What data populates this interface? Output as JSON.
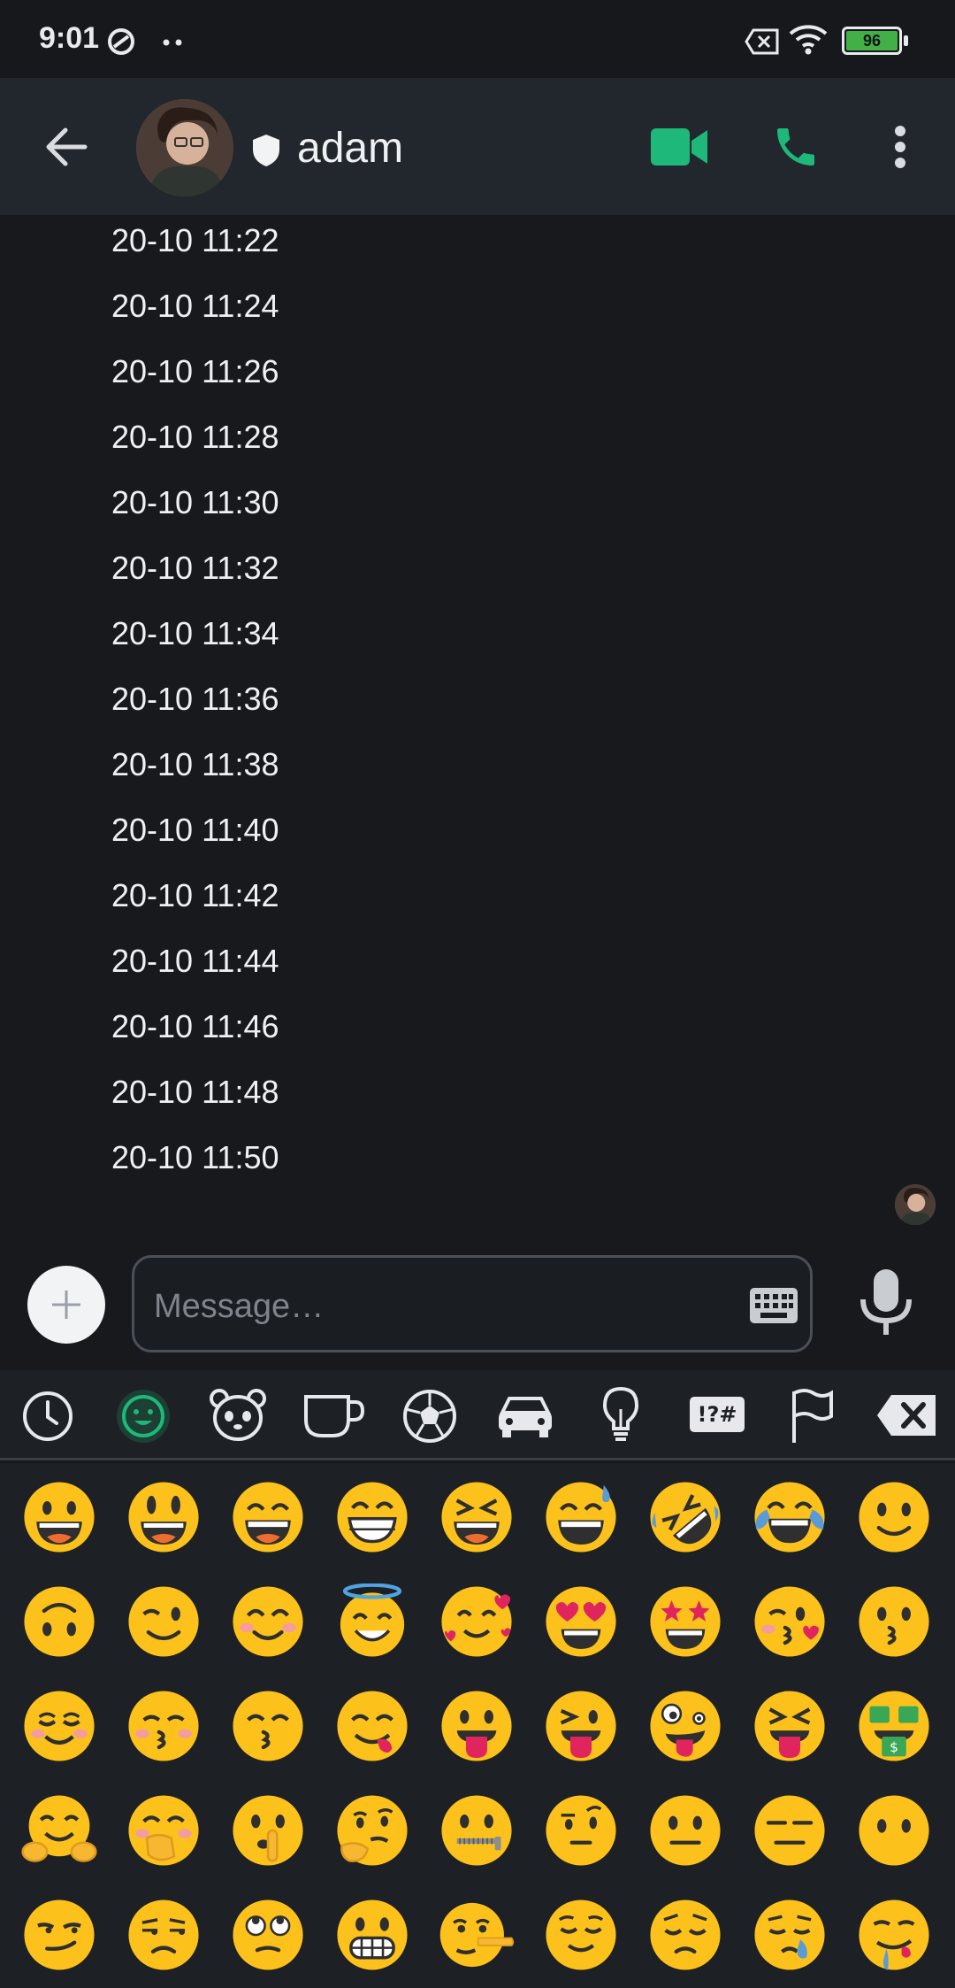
{
  "status_bar": {
    "time": "9:01",
    "battery": "96",
    "icons": [
      "do-not-disturb-icon",
      "more-notifications-icon",
      "no-sim-icon",
      "wifi-icon",
      "battery-icon"
    ]
  },
  "header": {
    "contact_name": "adam",
    "icons": [
      "back-arrow-icon",
      "shield-icon",
      "video-call-icon",
      "phone-icon",
      "more-vert-icon"
    ],
    "accent": "#1db87a"
  },
  "messages": {
    "timestamps": [
      "20-10 11:22",
      "20-10 11:24",
      "20-10 11:26",
      "20-10 11:28",
      "20-10 11:30",
      "20-10 11:32",
      "20-10 11:34",
      "20-10 11:36",
      "20-10 11:38",
      "20-10 11:40",
      "20-10 11:42",
      "20-10 11:44",
      "20-10 11:46",
      "20-10 11:48",
      "20-10 11:50"
    ]
  },
  "composer": {
    "placeholder": "Message…",
    "icons": [
      "add-icon",
      "keyboard-icon",
      "mic-icon"
    ]
  },
  "emoji_keyboard": {
    "tabs": [
      {
        "name": "recent-icon",
        "selected": false
      },
      {
        "name": "smileys-icon",
        "selected": true
      },
      {
        "name": "animals-icon",
        "selected": false
      },
      {
        "name": "food-icon",
        "selected": false
      },
      {
        "name": "activity-icon",
        "selected": false
      },
      {
        "name": "travel-icon",
        "selected": false
      },
      {
        "name": "objects-icon",
        "selected": false
      },
      {
        "name": "symbols-icon",
        "selected": false
      },
      {
        "name": "flags-icon",
        "selected": false
      },
      {
        "name": "backspace-icon",
        "selected": false
      }
    ],
    "symbols_label": "!?#",
    "emojis": [
      "grinning",
      "grinning-big-eyes",
      "grinning-smiling-eyes",
      "beaming",
      "squinting-laugh",
      "sweat-smile",
      "rofl",
      "tears-of-joy",
      "slight-smile",
      "upside-down",
      "wink",
      "smiling-eyes",
      "halo",
      "hearts",
      "heart-eyes",
      "star-struck",
      "kissing-heart",
      "kissing",
      "blush",
      "kissing-closed-eyes",
      "kissing-smiling-eyes",
      "yum",
      "tongue",
      "winking-tongue",
      "zany",
      "squinting-tongue",
      "money-mouth",
      "hugging",
      "hand-over-mouth",
      "shushing",
      "thinking",
      "zipper-mouth",
      "raised-eyebrow",
      "neutral",
      "expressionless",
      "no-mouth",
      "smirk",
      "unamused",
      "eye-roll",
      "grimacing",
      "lying",
      "relieved",
      "pensive",
      "sleepy",
      "drooling"
    ]
  }
}
